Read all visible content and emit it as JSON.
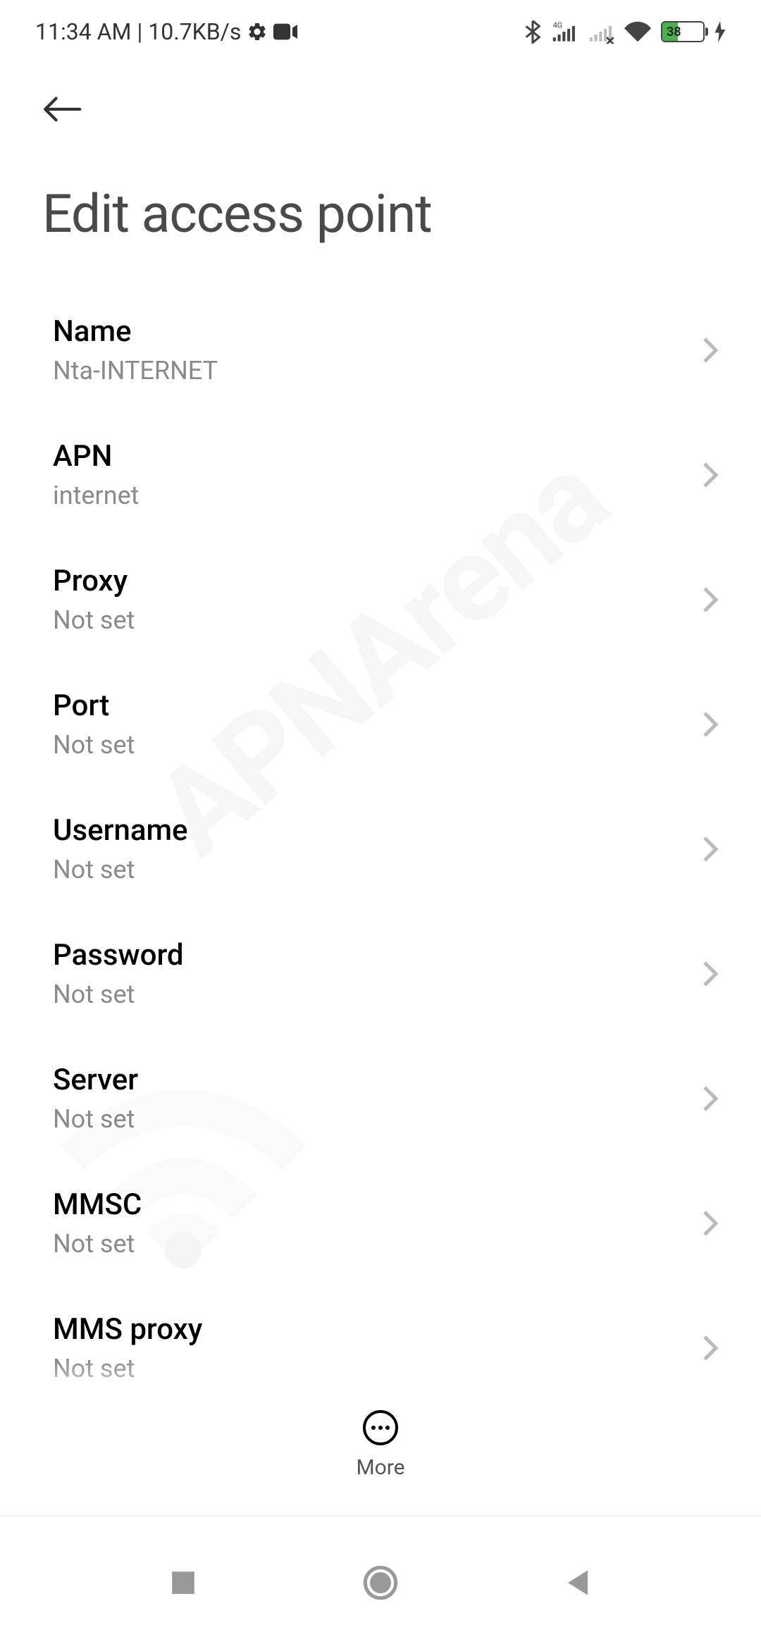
{
  "statusBar": {
    "time": "11:34 AM",
    "separator": "|",
    "dataRate": "10.7KB/s",
    "batteryPercent": "38"
  },
  "header": {
    "title": "Edit access point"
  },
  "settings": [
    {
      "label": "Name",
      "value": "Nta-INTERNET"
    },
    {
      "label": "APN",
      "value": "internet"
    },
    {
      "label": "Proxy",
      "value": "Not set"
    },
    {
      "label": "Port",
      "value": "Not set"
    },
    {
      "label": "Username",
      "value": "Not set"
    },
    {
      "label": "Password",
      "value": "Not set"
    },
    {
      "label": "Server",
      "value": "Not set"
    },
    {
      "label": "MMSC",
      "value": "Not set"
    },
    {
      "label": "MMS proxy",
      "value": "Not set"
    }
  ],
  "bottomAction": {
    "moreLabel": "More"
  },
  "watermark": "APNArena"
}
